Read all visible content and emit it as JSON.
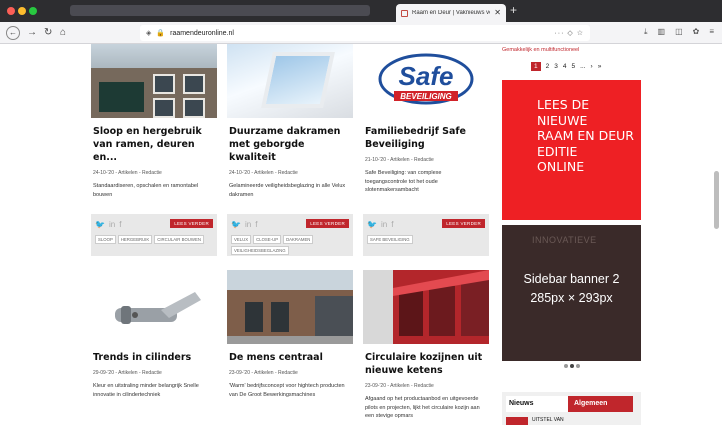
{
  "browser": {
    "tab_title": "Raam en Deur | Vaknieuws voo",
    "url": "raamendeuronline.nl"
  },
  "articles": [
    {
      "title": "Sloop en hergebruik van ramen, deuren en...",
      "meta": "24-10-'20 - Artikelen - Redactie",
      "excerpt": "Standaardiseren, opschalen en ramontabel bouwen",
      "read_more": "LEES VERDER",
      "tags": [
        "SLOOP",
        "HERGEBRUIK",
        "CIRCULAIR BOUWEN"
      ]
    },
    {
      "title": "Duurzame dakramen met geborgde kwaliteit",
      "meta": "24-10-'20 - Artikelen - Redactie",
      "excerpt": "Gelamineerde veiligheidsbeglazing in alle Velux dakramen",
      "read_more": "LEES VERDER",
      "tags": [
        "VELUX",
        "CLOSE-UP",
        "DAKRAMEN",
        "VEILIGHEIDSBEGLAZING"
      ]
    },
    {
      "title": "Familiebedrijf Safe Beveiliging",
      "meta": "21-10-'20 - Artikelen - Redactie",
      "excerpt": "Safe Beveiliging: van complexe toegangscontrole tot het oude slotenmakersambacht",
      "read_more": "LEES VERDER",
      "tags": [
        "SAFE BEVEILIGING"
      ],
      "logo_big": "Safe",
      "logo_small": "BEVEILIGING"
    },
    {
      "title": "Trends in cilinders",
      "meta": "29-09-'20 - Artikelen - Redactie",
      "excerpt": "Kleur en uitstraling minder belangrijk Snelle innovatie in cilindertechniek"
    },
    {
      "title": "De mens centraal",
      "meta": "23-09-'20 - Artikelen - Redactie",
      "excerpt": "'Warm' bedrijfsconcept voor hightech producten van De Groot Bewerkingsmachines"
    },
    {
      "title": "Circulaire kozijnen uit nieuwe ketens",
      "meta": "23-09-'20 - Artikelen - Redactie",
      "excerpt": "Afgaand op het productaanbod en uitgevoerde pilots en projecten, lijkt het circulaire kozijn aan een stevige opmars"
    }
  ],
  "sidebar": {
    "caption": "Gemakkelijk en multifunctioneel",
    "pagination": [
      "1",
      "2",
      "3",
      "4",
      "5",
      "...",
      "›",
      "»"
    ],
    "promo_lines": [
      "LEES DE",
      "NIEUWE",
      "RAAM EN DEUR",
      "EDITIE",
      "ONLINE"
    ],
    "banner_bg_text": "INNOVATIEVE",
    "banner_line1": "Sidebar banner 2",
    "banner_line2": "285px × 293px",
    "news_tab": "Nieuws",
    "general_tab": "Algemeen",
    "news_item": "UITSTEL VAN"
  },
  "colors": {
    "accent": "#c0262c",
    "promo": "#ee2024"
  }
}
